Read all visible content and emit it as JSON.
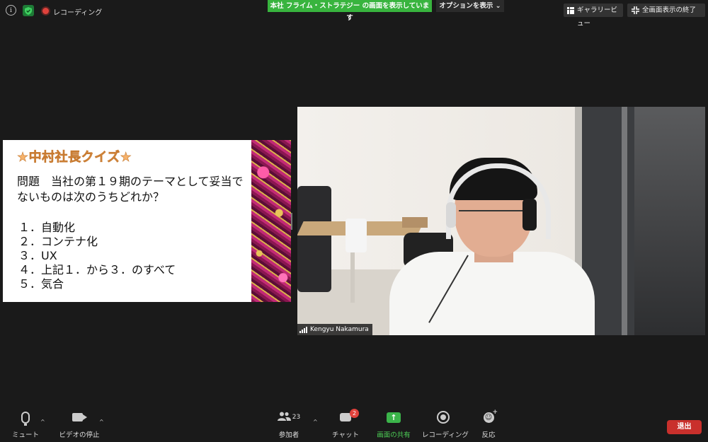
{
  "top_bar": {
    "recording_label": "レコーディング",
    "share_banner": "本社 フライム・ストラテジー の画面を表示しています",
    "options_label": "オプションを表示",
    "options_chevron": "⌄",
    "gallery_view_label": "ギャラリービュー",
    "exit_fullscreen_label": "全画面表示の終了"
  },
  "slide": {
    "title": "★中村社長クイズ★",
    "question": "問題　当社の第１９期のテーマとして妥当でないものは次のうちどれか？",
    "options": [
      "１．自動化",
      "２．コンテナ化",
      "３．UX",
      "４．上記１．から３．のすべて",
      "５．気合"
    ]
  },
  "video": {
    "participant_name": "Kengyu Nakamura"
  },
  "toolbar": {
    "mute_label": "ミュート",
    "video_stop_label": "ビデオの停止",
    "participants_label": "参加者",
    "participants_count": "23",
    "chat_label": "チャット",
    "chat_badge": "2",
    "share_screen_label": "画面の共有",
    "share_screen_symbol": "↑",
    "recording_label": "レコーディング",
    "reaction_label": "反応",
    "leave_label": "退出",
    "caret": "^"
  },
  "colors": {
    "background": "#1a1a1a",
    "share_banner": "#38b43e",
    "leave_button": "#c9302c",
    "record_dot": "#e0423c",
    "slide_title": "#f6b26b"
  },
  "icons": [
    "info-icon",
    "shield-icon",
    "record-icon",
    "grid-icon",
    "exit-fullscreen-icon",
    "microphone-icon",
    "camera-icon",
    "participants-icon",
    "chat-icon",
    "share-screen-icon",
    "reaction-icon",
    "signal-icon"
  ]
}
